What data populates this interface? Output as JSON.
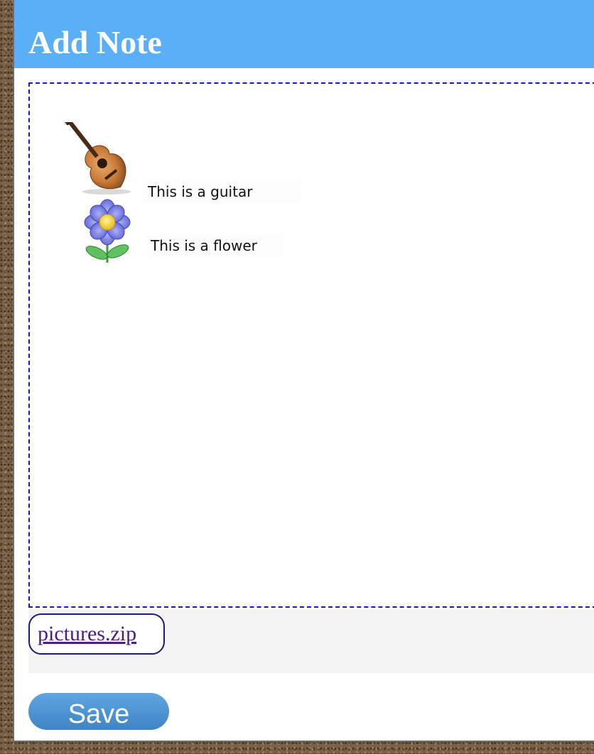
{
  "header": {
    "title": "Add Note"
  },
  "note": {
    "items": [
      {
        "icon": "guitar-icon",
        "caption": "This is a guitar"
      },
      {
        "icon": "flower-icon",
        "caption": "This is a flower"
      }
    ]
  },
  "attachments": {
    "files": [
      {
        "name": "pictures.zip"
      }
    ]
  },
  "actions": {
    "save_label": "Save"
  },
  "colors": {
    "header_bg": "#5baff7",
    "dropzone_border": "#1515d6",
    "save_button": "#4a90d0",
    "link": "#4b1b8c"
  }
}
